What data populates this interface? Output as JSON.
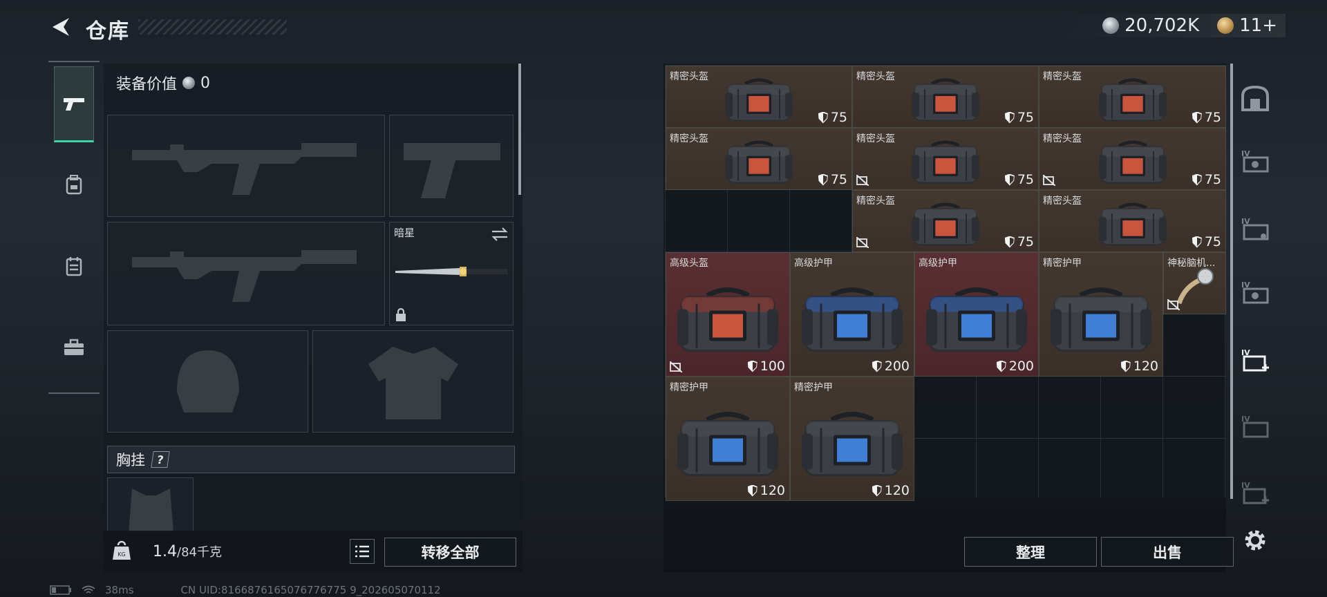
{
  "header": {
    "title": "仓库",
    "coins": "20,702K",
    "medals": "11+"
  },
  "equipment": {
    "value_label": "装备价值",
    "value": "0",
    "melee_name": "暗星",
    "chest_label": "胸挂",
    "chest_help": "?",
    "weight_current": "1.4",
    "weight_max": "/84千克",
    "transfer_all": "转移全部"
  },
  "storage": {
    "sort_label": "整理",
    "sell_label": "出售",
    "items": [
      {
        "name": "精密头盔",
        "value": "75",
        "tone": "brown",
        "uninsured": false
      },
      {
        "name": "精密头盔",
        "value": "75",
        "tone": "brown",
        "uninsured": false
      },
      {
        "name": "精密头盔",
        "value": "75",
        "tone": "brown",
        "uninsured": false
      },
      {
        "name": "精密头盔",
        "value": "75",
        "tone": "brown",
        "uninsured": false
      },
      {
        "name": "精密头盔",
        "value": "75",
        "tone": "brown",
        "uninsured": true
      },
      {
        "name": "精密头盔",
        "value": "75",
        "tone": "brown",
        "uninsured": true
      },
      {
        "name": "精密头盔",
        "value": "75",
        "tone": "brown",
        "uninsured": true
      },
      {
        "name": "精密头盔",
        "value": "75",
        "tone": "brown",
        "uninsured": false
      },
      {
        "name": "高级头盔",
        "value": "100",
        "tone": "red",
        "uninsured": true
      },
      {
        "name": "高级护甲",
        "value": "200",
        "tone": "brown",
        "uninsured": false
      },
      {
        "name": "高级护甲",
        "value": "200",
        "tone": "red",
        "uninsured": false
      },
      {
        "name": "精密护甲",
        "value": "120",
        "tone": "brown",
        "uninsured": false
      },
      {
        "name": "神秘脑机...",
        "value": "",
        "tone": "brown",
        "uninsured": true
      },
      {
        "name": "精密护甲",
        "value": "120",
        "tone": "brown",
        "uninsured": false
      },
      {
        "name": "精密护甲",
        "value": "120",
        "tone": "brown",
        "uninsured": false
      }
    ]
  },
  "status": {
    "ping": "38ms",
    "uid": "CN UID:8166876165076776775 9_202605070112"
  },
  "colors": {
    "accent": "#3fd3a5",
    "brown_cell": "#3e342c",
    "red_cell": "#52292d"
  }
}
